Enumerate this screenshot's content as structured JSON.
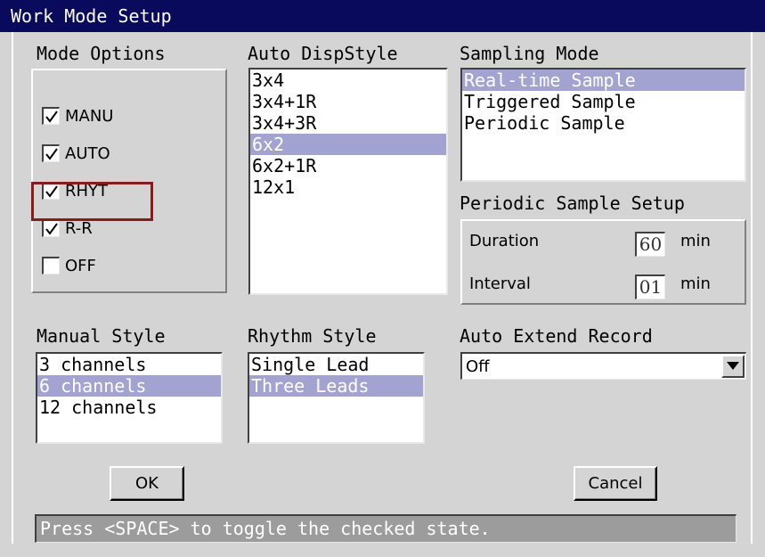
{
  "window": {
    "title": "Work Mode Setup"
  },
  "mode_options": {
    "label": "Mode Options",
    "items": [
      {
        "label": "MANU",
        "checked": true
      },
      {
        "label": "AUTO",
        "checked": true
      },
      {
        "label": "RHYT",
        "checked": true
      },
      {
        "label": "R-R",
        "checked": true
      },
      {
        "label": "OFF",
        "checked": false
      }
    ]
  },
  "auto_disp_style": {
    "label": "Auto DispStyle",
    "items": [
      "3x4",
      "3x4+1R",
      "3x4+3R",
      "6x2",
      "6x2+1R",
      "12x1"
    ],
    "selected": "6x2"
  },
  "sampling_mode": {
    "label": "Sampling Mode",
    "items": [
      "Real-time Sample",
      "Triggered Sample",
      "Periodic Sample"
    ],
    "selected": "Real-time Sample"
  },
  "periodic_sample_setup": {
    "label": "Periodic Sample Setup",
    "duration": {
      "label": "Duration",
      "value": "60",
      "unit": "min"
    },
    "interval": {
      "label": "Interval",
      "value": "01",
      "unit": "min"
    }
  },
  "manual_style": {
    "label": "Manual Style",
    "items": [
      "3 channels",
      "6 channels",
      "12 channels"
    ],
    "selected": "6 channels"
  },
  "rhythm_style": {
    "label": "Rhythm Style",
    "items": [
      "Single Lead",
      "Three Leads"
    ],
    "selected": "Three Leads"
  },
  "auto_extend_record": {
    "label": "Auto Extend Record",
    "value": "Off"
  },
  "buttons": {
    "ok": "OK",
    "cancel": "Cancel"
  },
  "status": "Press <SPACE> to toggle the checked state.",
  "colors": {
    "title_bar": "#0a0a5c",
    "selection": "#a3a3d2",
    "highlight_border": "#8b1a1a"
  },
  "icons": {
    "check": "check-icon",
    "dropdown": "triangle-down-icon"
  }
}
